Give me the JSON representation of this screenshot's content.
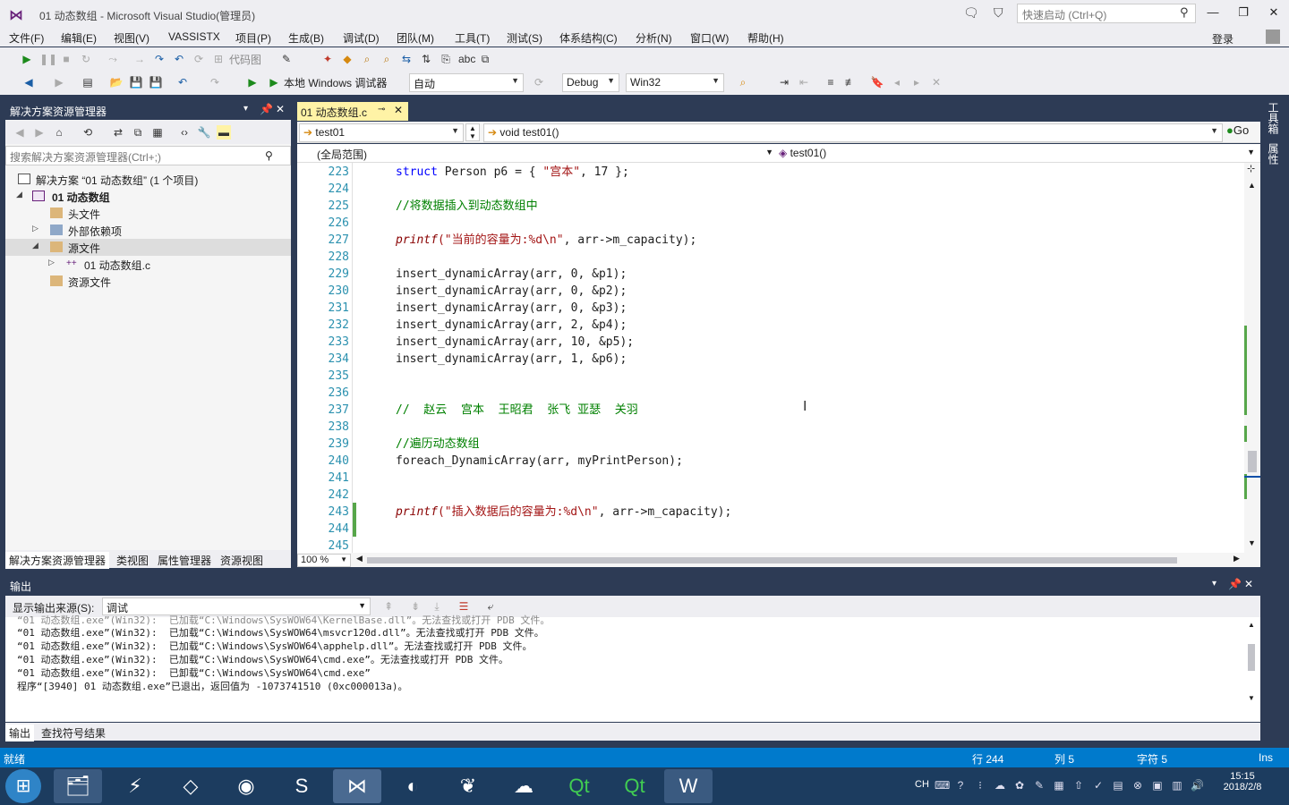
{
  "window": {
    "title": "01 动态数组 - Microsoft Visual Studio(管理员)",
    "quick_launch_placeholder": "快速启动 (Ctrl+Q)",
    "login": "登录"
  },
  "menu": [
    "文件(F)",
    "编辑(E)",
    "视图(V)",
    "VASSISTX",
    "项目(P)",
    "生成(B)",
    "调试(D)",
    "团队(M)",
    "工具(T)",
    "测试(S)",
    "体系结构(C)",
    "分析(N)",
    "窗口(W)",
    "帮助(H)"
  ],
  "toolbar": {
    "code_map": "代码图",
    "debugger": "本地 Windows 调试器",
    "auto": "自动",
    "config": "Debug",
    "platform": "Win32"
  },
  "solution_explorer": {
    "title": "解决方案资源管理器",
    "search_placeholder": "搜索解决方案资源管理器(Ctrl+;)",
    "tree": [
      {
        "label": "解决方案 “01 动态数组” (1 个项目)",
        "level": 0,
        "arrow": ""
      },
      {
        "label": "01 动态数组",
        "level": 1,
        "arrow": "▲",
        "bold": true
      },
      {
        "label": "头文件",
        "level": 2,
        "arrow": ""
      },
      {
        "label": "外部依赖项",
        "level": 2,
        "arrow": "▷"
      },
      {
        "label": "源文件",
        "level": 2,
        "arrow": "▲",
        "selected": true
      },
      {
        "label": "01 动态数组.c",
        "level": 3,
        "arrow": "▷"
      },
      {
        "label": "资源文件",
        "level": 2,
        "arrow": ""
      }
    ],
    "tabs": [
      "解决方案资源管理器",
      "类视图",
      "属性管理器",
      "资源视图"
    ]
  },
  "editor": {
    "tab_label": "01 动态数组.c",
    "nav_left": "test01",
    "nav_right": "void test01()",
    "go_label": "Go",
    "scope": "(全局范围)",
    "member": "test01()",
    "zoom": "100 %",
    "lines": [
      {
        "n": "223",
        "parts": [
          [
            "kw",
            "struct "
          ],
          [
            "",
            "Person p6 = { "
          ],
          [
            "str",
            "\"宫本\""
          ],
          [
            "",
            ", 17 };"
          ]
        ]
      },
      {
        "n": "224",
        "parts": []
      },
      {
        "n": "225",
        "parts": [
          [
            "cm",
            "//将数据插入到动态数组中"
          ]
        ]
      },
      {
        "n": "226",
        "parts": []
      },
      {
        "n": "227",
        "parts": [
          [
            "fn-italic",
            "printf"
          ],
          [
            "str",
            "(\"当前的容量为:%d\\n\""
          ],
          [
            "",
            ", arr->m_capacity);"
          ]
        ]
      },
      {
        "n": "228",
        "parts": []
      },
      {
        "n": "229",
        "parts": [
          [
            "",
            "insert_dynamicArray(arr, 0, &p1);"
          ]
        ]
      },
      {
        "n": "230",
        "parts": [
          [
            "",
            "insert_dynamicArray(arr, 0, &p2);"
          ]
        ]
      },
      {
        "n": "231",
        "parts": [
          [
            "",
            "insert_dynamicArray(arr, 0, &p3);"
          ]
        ]
      },
      {
        "n": "232",
        "parts": [
          [
            "",
            "insert_dynamicArray(arr, 2, &p4);"
          ]
        ]
      },
      {
        "n": "233",
        "parts": [
          [
            "",
            "insert_dynamicArray(arr, 10, &p5);"
          ]
        ]
      },
      {
        "n": "234",
        "parts": [
          [
            "",
            "insert_dynamicArray(arr, 1, &p6);"
          ]
        ]
      },
      {
        "n": "235",
        "parts": []
      },
      {
        "n": "236",
        "parts": []
      },
      {
        "n": "237",
        "parts": [
          [
            "cm",
            "//  赵云  宫本  王昭君  张飞 亚瑟  关羽"
          ]
        ]
      },
      {
        "n": "238",
        "parts": []
      },
      {
        "n": "239",
        "parts": [
          [
            "cm",
            "//遍历动态数组"
          ]
        ]
      },
      {
        "n": "240",
        "parts": [
          [
            "",
            "foreach_DynamicArray(arr, myPrintPerson);"
          ]
        ]
      },
      {
        "n": "241",
        "parts": []
      },
      {
        "n": "242",
        "parts": []
      },
      {
        "n": "243",
        "parts": [
          [
            "fn-italic",
            "printf"
          ],
          [
            "str",
            "(\"插入数据后的容量为:%d\\n\""
          ],
          [
            "",
            ", arr->m_capacity);"
          ]
        ]
      },
      {
        "n": "244",
        "parts": []
      },
      {
        "n": "245",
        "parts": []
      }
    ]
  },
  "output": {
    "title": "输出",
    "source_label": "显示输出来源(S):",
    "source_value": "调试",
    "lines": [
      "“01 动态数组.exe”(Win32):  已加载“C:\\Windows\\SysWOW64\\KernelBase.dll”。无法查找或打开 PDB 文件。",
      "“01 动态数组.exe”(Win32):  已加载“C:\\Windows\\SysWOW64\\msvcr120d.dll”。无法查找或打开 PDB 文件。",
      "“01 动态数组.exe”(Win32):  已加载“C:\\Windows\\SysWOW64\\apphelp.dll”。无法查找或打开 PDB 文件。",
      "“01 动态数组.exe”(Win32):  已加载“C:\\Windows\\SysWOW64\\cmd.exe”。无法查找或打开 PDB 文件。",
      "“01 动态数组.exe”(Win32):  已卸载“C:\\Windows\\SysWOW64\\cmd.exe”",
      "程序“[3940] 01 动态数组.exe”已退出，返回值为 -1073741510 (0xc000013a)。"
    ],
    "tabs": [
      "输出",
      "查找符号结果"
    ]
  },
  "right_tabs": [
    "工具箱",
    "属性"
  ],
  "status": {
    "ready": "就绪",
    "row": "行 244",
    "col": "列 5",
    "char": "字符 5",
    "ins": "Ins"
  },
  "taskbar": {
    "time": "15:15",
    "date": "2018/2/8",
    "lang": "CH"
  }
}
